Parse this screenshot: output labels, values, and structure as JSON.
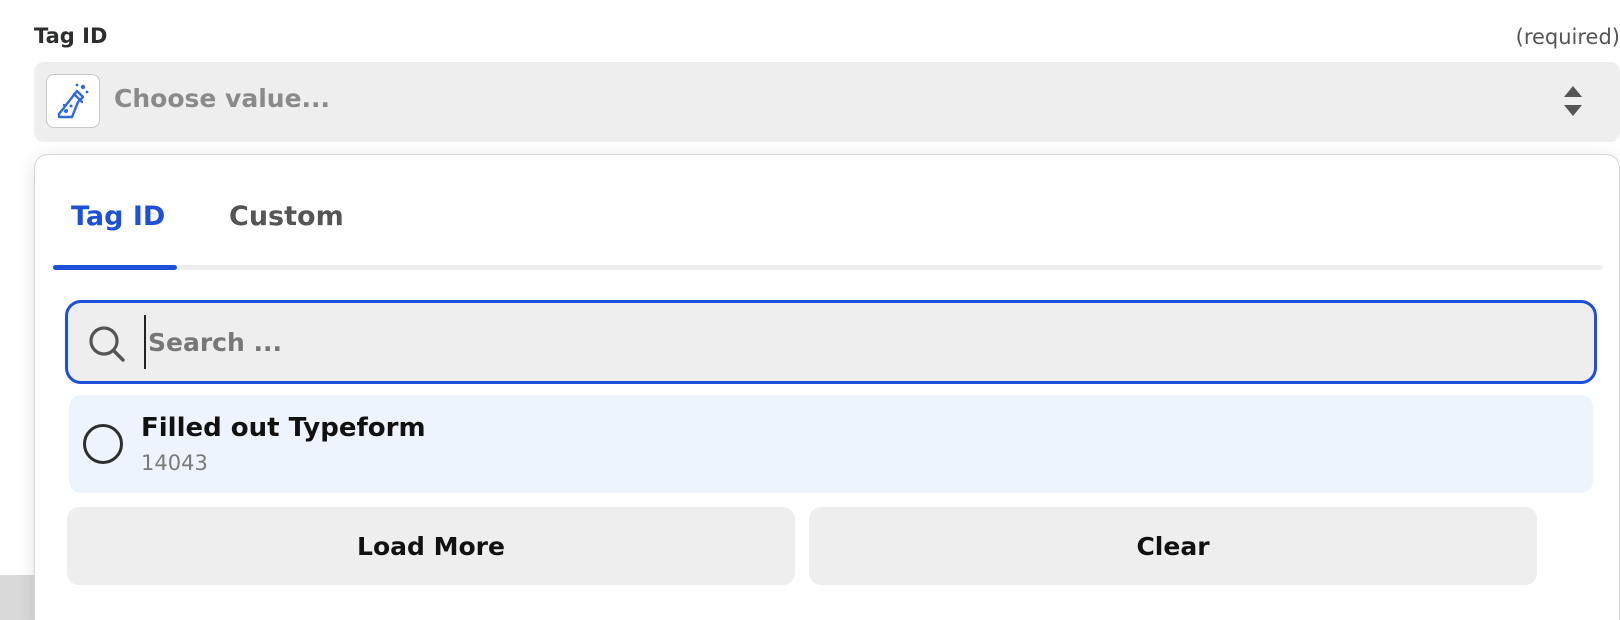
{
  "field": {
    "label": "Tag ID",
    "required_text": "(required)",
    "placeholder": "Choose value..."
  },
  "tabs": [
    {
      "label": "Tag ID",
      "active": true
    },
    {
      "label": "Custom",
      "active": false
    }
  ],
  "search": {
    "placeholder": "Search ..."
  },
  "options": [
    {
      "title": "Filled out Typeform",
      "subtitle": "14043",
      "selected": false
    }
  ],
  "buttons": {
    "load_more": "Load More",
    "clear": "Clear"
  },
  "icons": {
    "app": "flask-icon",
    "sort": "sort-arrows-icon",
    "search": "search-icon"
  },
  "colors": {
    "accent": "#1e4fd8",
    "field_bg": "#eeeeee",
    "option_bg": "#eef4fd",
    "text": "#2d2e2e"
  }
}
